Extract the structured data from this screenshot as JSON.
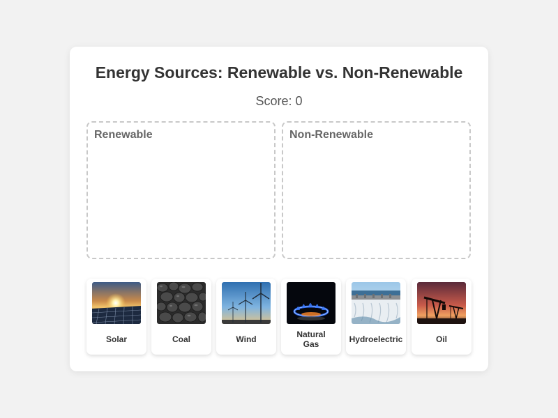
{
  "game": {
    "title": "Energy Sources: Renewable vs. Non-Renewable",
    "score_text": "Score: 0"
  },
  "zones": {
    "renewable": {
      "label": "Renewable"
    },
    "non_renewable": {
      "label": "Non-Renewable"
    }
  },
  "items": [
    {
      "label": "Solar",
      "icon": "solar-panel-image"
    },
    {
      "label": "Coal",
      "icon": "coal-image"
    },
    {
      "label": "Wind",
      "icon": "wind-turbine-image"
    },
    {
      "label": "Natural Gas",
      "icon": "gas-flame-image"
    },
    {
      "label": "Hydroelectric",
      "icon": "dam-image"
    },
    {
      "label": "Oil",
      "icon": "oil-pump-image"
    }
  ],
  "colors": {
    "background": "#f2f2f2",
    "card": "#ffffff",
    "title": "#333333",
    "zone_border": "#c8c8c8"
  }
}
